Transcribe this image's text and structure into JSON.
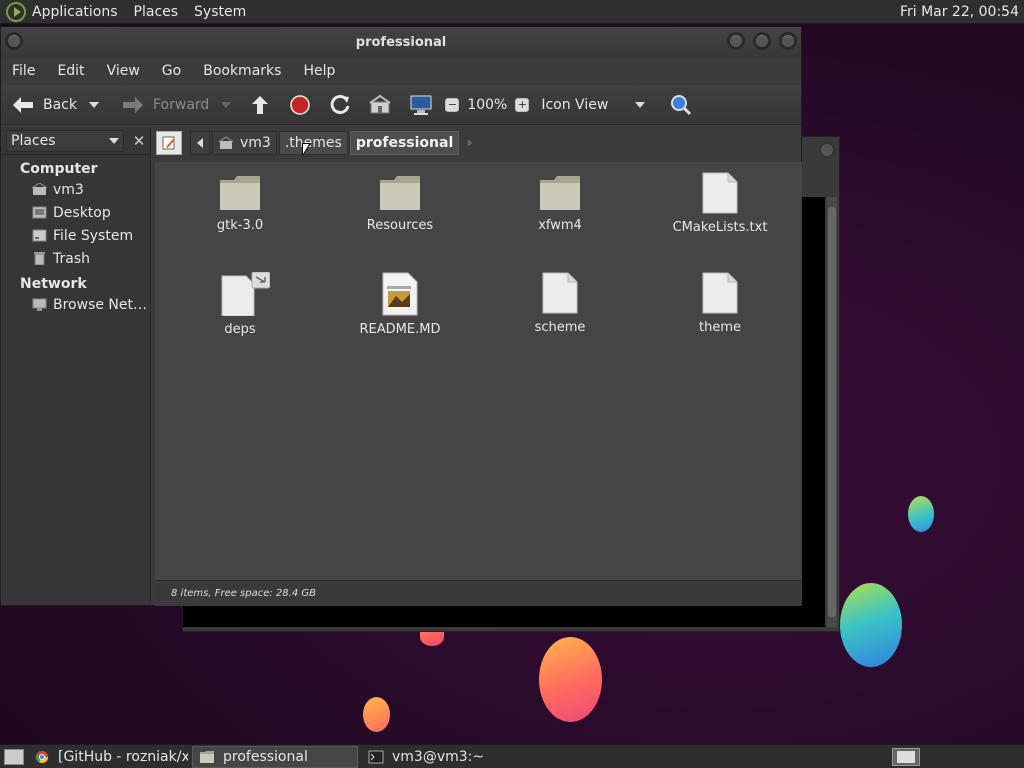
{
  "top_panel": {
    "menus": [
      "Applications",
      "Places",
      "System"
    ],
    "clock": "Fri Mar 22, 00:54"
  },
  "window": {
    "title": "professional",
    "menubar": [
      "File",
      "Edit",
      "View",
      "Go",
      "Bookmarks",
      "Help"
    ],
    "toolbar": {
      "back": "Back",
      "forward": "Forward",
      "zoom": "100%",
      "view_mode": "Icon View"
    },
    "sidepane": {
      "selector": "Places",
      "sections": [
        {
          "title": "Computer",
          "items": [
            "vm3",
            "Desktop",
            "File System",
            "Trash"
          ]
        },
        {
          "title": "Network",
          "items": [
            "Browse Net…"
          ]
        }
      ]
    },
    "path": [
      "vm3",
      ".themes",
      "professional"
    ],
    "files": [
      {
        "name": "gtk-3.0",
        "kind": "folder"
      },
      {
        "name": "Resources",
        "kind": "folder"
      },
      {
        "name": "xfwm4",
        "kind": "folder"
      },
      {
        "name": "CMakeLists.txt",
        "kind": "file"
      },
      {
        "name": "deps",
        "kind": "link"
      },
      {
        "name": "README.MD",
        "kind": "image"
      },
      {
        "name": "scheme",
        "kind": "file"
      },
      {
        "name": "theme",
        "kind": "file"
      }
    ],
    "status": "8 items, Free space: 28.4 GB"
  },
  "taskbar": {
    "tasks": [
      {
        "label": "[GitHub - rozniak/xf…",
        "icon": "chrome-icon",
        "active": false
      },
      {
        "label": "professional",
        "icon": "folder-icon",
        "active": true
      },
      {
        "label": "vm3@vm3:~",
        "icon": "terminal-icon",
        "active": false
      }
    ]
  },
  "colors": {
    "panel": "#2f2f2f",
    "window": "#3b3b3b",
    "iconview": "#454545",
    "desktop": "#250a27"
  }
}
